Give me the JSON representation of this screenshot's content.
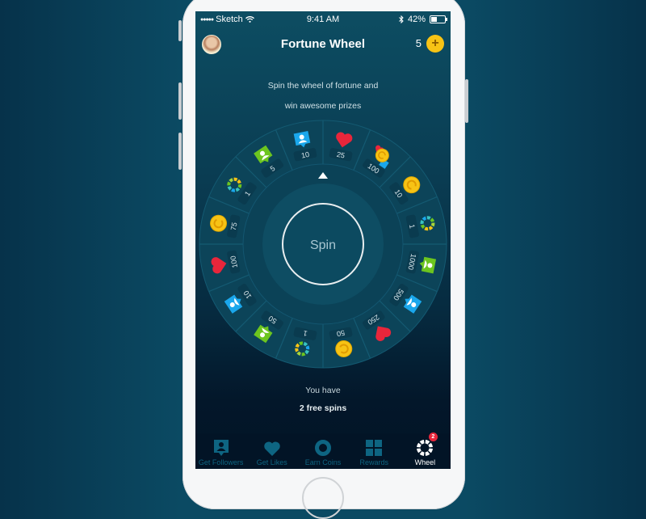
{
  "status_bar": {
    "carrier": "Sketch",
    "time": "9:41 AM",
    "battery_percent": "42%",
    "battery_level": 0.42
  },
  "header": {
    "title": "Fortune Wheel",
    "coin_count": "5",
    "add_symbol": "+"
  },
  "intro": {
    "line1": "Spin the wheel of fortune and",
    "line2": "win awesome prizes"
  },
  "wheel": {
    "spin_label": "Spin",
    "segments": [
      {
        "value": "10",
        "icon": "follower-icon",
        "color": "#1aa7ec"
      },
      {
        "value": "25",
        "icon": "heart-icon",
        "color": "#e8263b"
      },
      {
        "value": "100",
        "icon": "combo-icon",
        "color": "#f7c315"
      },
      {
        "value": "10",
        "icon": "coin-icon",
        "color": "#f7c315"
      },
      {
        "value": "1",
        "icon": "wheel-icon",
        "color": "#39c3c0"
      },
      {
        "value": "1000",
        "icon": "follower-icon",
        "color": "#6cc51f"
      },
      {
        "value": "500",
        "icon": "follower-icon",
        "color": "#1aa7ec"
      },
      {
        "value": "250",
        "icon": "heart-icon",
        "color": "#e8263b"
      },
      {
        "value": "50",
        "icon": "coin-icon",
        "color": "#f7c315"
      },
      {
        "value": "1",
        "icon": "wheel-icon",
        "color": "#39c3c0"
      },
      {
        "value": "50",
        "icon": "follower-icon",
        "color": "#6cc51f"
      },
      {
        "value": "10",
        "icon": "follower-icon",
        "color": "#1aa7ec"
      },
      {
        "value": "100",
        "icon": "heart-icon",
        "color": "#e8263b"
      },
      {
        "value": "75",
        "icon": "coin-icon",
        "color": "#f7c315"
      },
      {
        "value": "1",
        "icon": "wheel-icon",
        "color": "#39c3c0"
      },
      {
        "value": "5",
        "icon": "follower-icon",
        "color": "#6cc51f"
      }
    ]
  },
  "spins": {
    "prefix": "You have",
    "count_text": "2 free spins"
  },
  "tabs": [
    {
      "label": "Get Followers",
      "icon": "follower-icon",
      "active": false
    },
    {
      "label": "Get Likes",
      "icon": "heart-icon",
      "active": false
    },
    {
      "label": "Earn Coins",
      "icon": "coin-ring-icon",
      "active": false
    },
    {
      "label": "Rewards",
      "icon": "grid-icon",
      "active": false
    },
    {
      "label": "Wheel",
      "icon": "wheel-icon",
      "active": true,
      "badge": "2"
    }
  ],
  "colors": {
    "accent_yellow": "#f7c315",
    "badge_red": "#e8263b",
    "tab_inactive": "#0e6582"
  }
}
